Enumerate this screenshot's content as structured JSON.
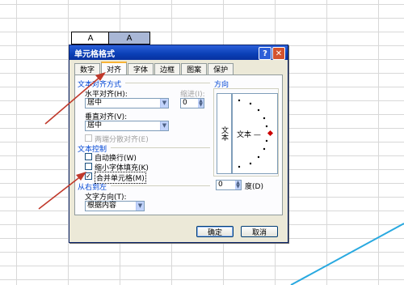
{
  "spreadsheet": {
    "cell_a": "A",
    "cell_b": "A"
  },
  "dialog": {
    "title": "单元格格式",
    "tabs": [
      "数字",
      "对齐",
      "字体",
      "边框",
      "图案",
      "保护"
    ],
    "active_tab": "对齐",
    "text_align_group": "文本对齐方式",
    "horizontal_label": "水平对齐(H):",
    "horizontal_value": "居中",
    "indent_label": "缩进(I):",
    "indent_value": "0",
    "vertical_label": "垂直对齐(V):",
    "vertical_value": "居中",
    "distributed_label": "两端分散对齐(E)",
    "text_control_group": "文本控制",
    "wrap_label": "自动换行(W)",
    "shrink_label": "缩小字体填充(K)",
    "merge_label": "合并单元格(M)",
    "merge_checked": "✓",
    "rtl_group": "从右到左",
    "direction_label": "文字方向(T):",
    "direction_value": "根据内容",
    "orientation_group": "方向",
    "orientation_vertical_text": "文本",
    "orientation_horizontal_text": "文本 —",
    "degree_value": "0",
    "degree_label": "度(D)",
    "ok_label": "确定",
    "cancel_label": "取消",
    "help_icon": "?",
    "close_icon": "✕",
    "dropdown_glyph": "▼",
    "spin_up": "▲",
    "spin_down": "▼"
  },
  "colors": {
    "title_bar": "#0a3fb5",
    "dialog_bg": "#ece9d8",
    "arrow": "#c0392b",
    "selection": "#a9b7d6",
    "diagonal": "#29a9e0"
  }
}
